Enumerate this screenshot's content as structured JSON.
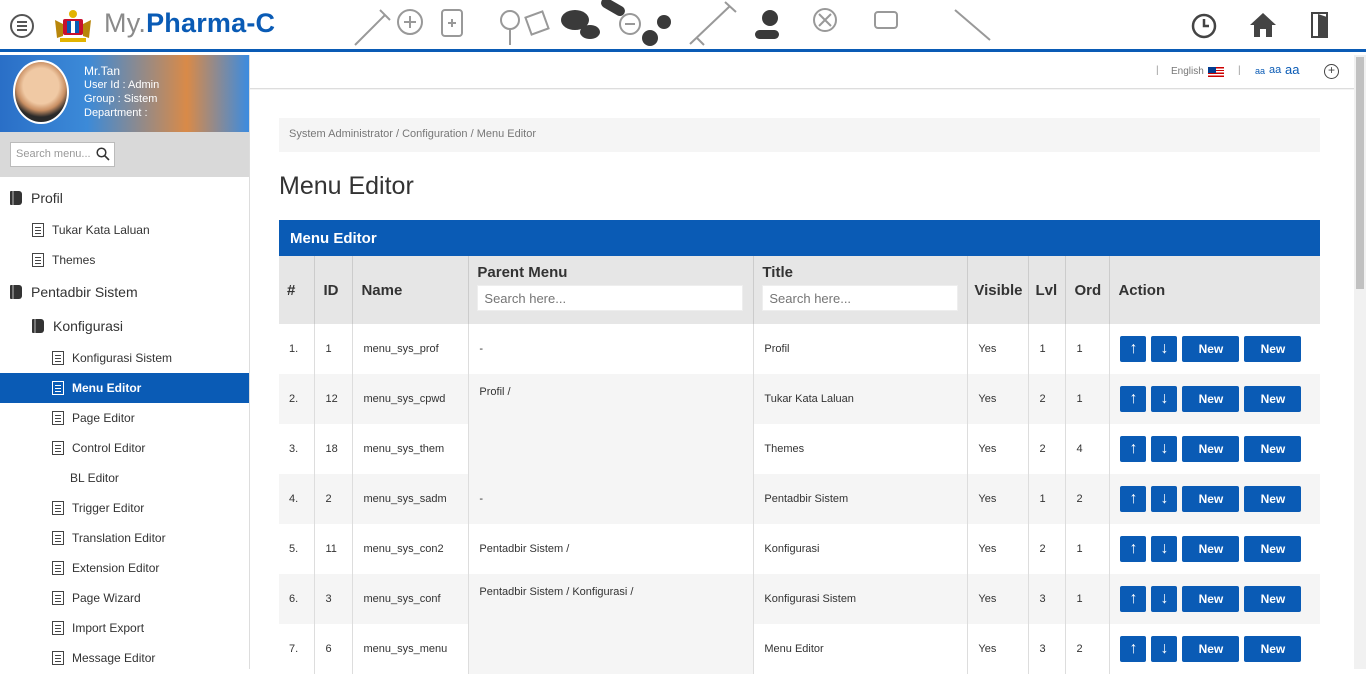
{
  "header": {
    "brand_prefix": "My.",
    "brand_name": "Pharma-C"
  },
  "user": {
    "name": "Mr.Tan",
    "user_id": "User Id : Admin",
    "group": "Group : Sistem",
    "department": "Department :"
  },
  "sidebar": {
    "search_placeholder": "Search menu...",
    "items": [
      {
        "label": "Profil",
        "level": 0,
        "icon": "book-icon"
      },
      {
        "label": "Tukar Kata Laluan",
        "level": 1,
        "icon": "document-icon"
      },
      {
        "label": "Themes",
        "level": 1,
        "icon": "document-icon"
      },
      {
        "label": "Pentadbir Sistem",
        "level": 0,
        "icon": "book-icon"
      },
      {
        "label": "Konfigurasi",
        "level": 1,
        "icon": "book-icon"
      },
      {
        "label": "Konfigurasi Sistem",
        "level": 2,
        "icon": "document-icon"
      },
      {
        "label": "Menu Editor",
        "level": 2,
        "icon": "document-icon",
        "active": true
      },
      {
        "label": "Page Editor",
        "level": 2,
        "icon": "document-icon"
      },
      {
        "label": "Control Editor",
        "level": 2,
        "icon": "document-icon"
      },
      {
        "label": "BL Editor",
        "level": 2,
        "icon": ""
      },
      {
        "label": "Trigger Editor",
        "level": 2,
        "icon": "document-icon"
      },
      {
        "label": "Translation Editor",
        "level": 2,
        "icon": "document-icon"
      },
      {
        "label": "Extension Editor",
        "level": 2,
        "icon": "document-icon"
      },
      {
        "label": "Page Wizard",
        "level": 2,
        "icon": "document-icon"
      },
      {
        "label": "Import Export",
        "level": 2,
        "icon": "document-icon"
      },
      {
        "label": "Message Editor",
        "level": 2,
        "icon": "document-icon"
      }
    ]
  },
  "langbar": {
    "language": "English",
    "font_small": "aa",
    "font_medium": "aa",
    "font_large": "aa"
  },
  "breadcrumb": "System Administrator / Configuration / Menu Editor",
  "page_title": "Menu Editor",
  "panel_title": "Menu Editor",
  "table": {
    "headers": {
      "num": "#",
      "id": "ID",
      "name": "Name",
      "parent": "Parent Menu",
      "title": "Title",
      "visible": "Visible",
      "lvl": "Lvl",
      "ord": "Ord",
      "action": "Action"
    },
    "parent_placeholder": "Search here...",
    "title_placeholder": "Search here...",
    "up_label": "↑",
    "down_label": "↓",
    "new_label": "New",
    "rows": [
      {
        "num": "1.",
        "id": "1",
        "name": "menu_sys_prof",
        "parent": "-",
        "title": "Profil",
        "visible": "Yes",
        "lvl": "1",
        "ord": "1"
      },
      {
        "num": "2.",
        "id": "12",
        "name": "menu_sys_cpwd",
        "parent": "Profil /",
        "title": "Tukar Kata Laluan",
        "visible": "Yes",
        "lvl": "2",
        "ord": "1"
      },
      {
        "num": "3.",
        "id": "18",
        "name": "menu_sys_them",
        "parent": "",
        "title": "Themes",
        "visible": "Yes",
        "lvl": "2",
        "ord": "4"
      },
      {
        "num": "4.",
        "id": "2",
        "name": "menu_sys_sadm",
        "parent": "-",
        "title": "Pentadbir Sistem",
        "visible": "Yes",
        "lvl": "1",
        "ord": "2"
      },
      {
        "num": "5.",
        "id": "11",
        "name": "menu_sys_con2",
        "parent": "Pentadbir Sistem /",
        "title": "Konfigurasi",
        "visible": "Yes",
        "lvl": "2",
        "ord": "1"
      },
      {
        "num": "6.",
        "id": "3",
        "name": "menu_sys_conf",
        "parent": "Pentadbir Sistem / Konfigurasi /",
        "title": "Konfigurasi Sistem",
        "visible": "Yes",
        "lvl": "3",
        "ord": "1"
      },
      {
        "num": "7.",
        "id": "6",
        "name": "menu_sys_menu",
        "parent": "",
        "title": "Menu Editor",
        "visible": "Yes",
        "lvl": "3",
        "ord": "2"
      }
    ]
  },
  "colors": {
    "accent": "#0a5bb5",
    "header_bg": "#e6e6e6"
  }
}
